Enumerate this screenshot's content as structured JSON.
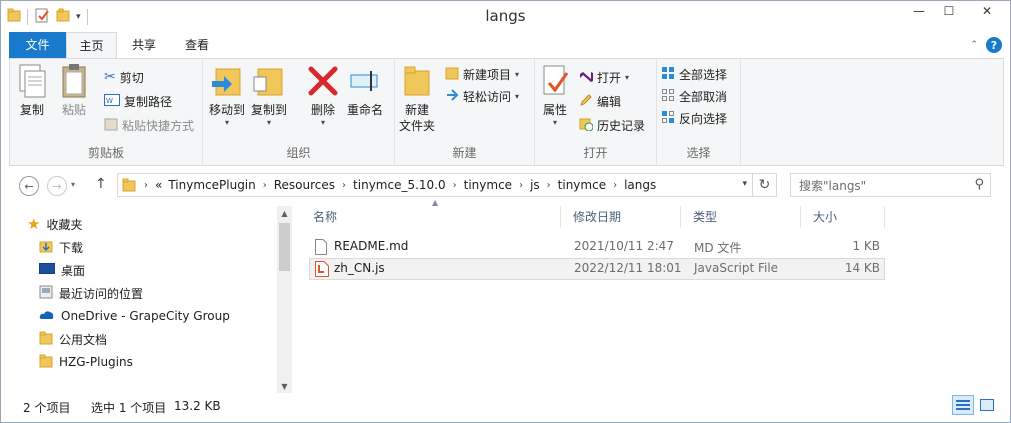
{
  "window": {
    "title": "langs"
  },
  "tabs": {
    "file": "文件",
    "home": "主页",
    "share": "共享",
    "view": "查看"
  },
  "ribbon": {
    "clipboard": {
      "label": "剪贴板",
      "copy": "复制",
      "paste": "粘贴",
      "cut": "剪切",
      "copy_path": "复制路径",
      "paste_shortcut": "粘贴快捷方式"
    },
    "organize": {
      "label": "组织",
      "move_to": "移动到",
      "copy_to": "复制到",
      "delete": "删除",
      "rename": "重命名"
    },
    "new": {
      "label": "新建",
      "new_folder": "新建\n文件夹",
      "new_item": "新建项目",
      "easy_access": "轻松访问"
    },
    "open": {
      "label": "打开",
      "properties": "属性",
      "open": "打开",
      "edit": "编辑",
      "history": "历史记录"
    },
    "select": {
      "label": "选择",
      "select_all": "全部选择",
      "select_none": "全部取消",
      "invert": "反向选择"
    }
  },
  "address": {
    "overflow": "«",
    "crumbs": [
      "TinymcePlugin",
      "Resources",
      "tinymce_5.10.0",
      "tinymce",
      "js",
      "tinymce",
      "langs"
    ]
  },
  "search": {
    "placeholder": "搜索\"langs\""
  },
  "nav_pane": {
    "favorites": "收藏夹",
    "items": [
      "下载",
      "桌面",
      "最近访问的位置"
    ],
    "onedrive": "OneDrive - GrapeCity Group",
    "public_docs": "公用文档",
    "hzg": "HZG-Plugins"
  },
  "columns": {
    "name": "名称",
    "modified": "修改日期",
    "type": "类型",
    "size": "大小"
  },
  "files": [
    {
      "name": "README.md",
      "modified": "2021/10/11 2:47",
      "type": "MD 文件",
      "size": "1 KB"
    },
    {
      "name": "zh_CN.js",
      "modified": "2022/12/11 18:01",
      "type": "JavaScript File",
      "size": "14 KB"
    }
  ],
  "status": {
    "count": "2 个项目",
    "selected": "选中 1 个项目",
    "size": "13.2 KB"
  },
  "colors": {
    "accent": "#1979ca",
    "folder": "#f1c65a",
    "header_text": "#4c607a"
  }
}
